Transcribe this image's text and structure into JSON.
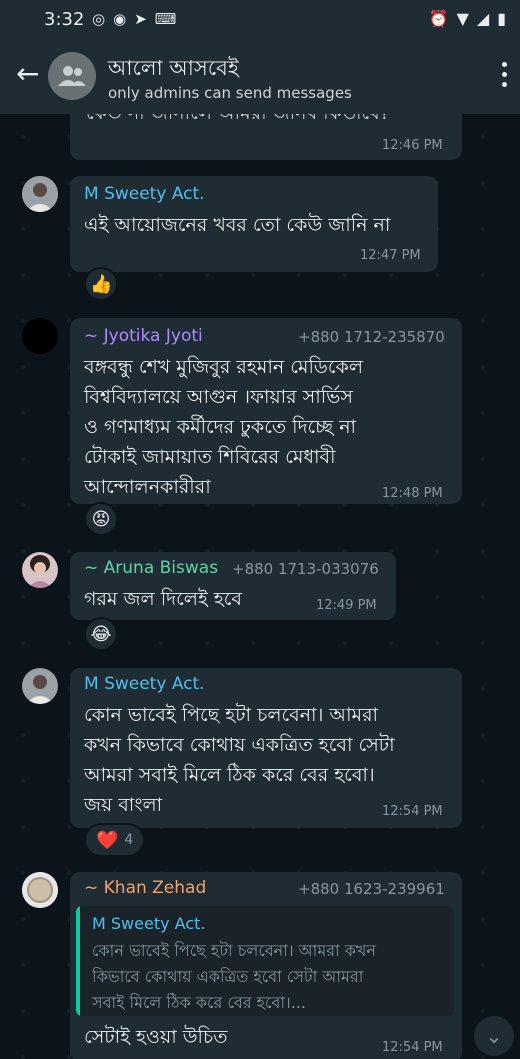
{
  "status_bar": {
    "time": "3:32",
    "left_icons": [
      "whatsapp-icon",
      "messenger-icon",
      "telegram-icon",
      "keyboard-icon"
    ],
    "right_icons": [
      "alarm-icon",
      "wifi-icon",
      "signal-icon",
      "battery-icon"
    ]
  },
  "header": {
    "title": "আলো আসবেই",
    "subtitle": "only admins can send messages"
  },
  "messages": [
    {
      "text": "কেউ না জানালে আমরা জানব কিভাবে?",
      "time": "12:46 PM"
    },
    {
      "sender": "M Sweety Act.",
      "text": "এই আয়োজনের খবর তো কেউ জানি না",
      "time": "12:47 PM",
      "reaction": "👍"
    },
    {
      "sender": "~ Jyotika Jyoti",
      "phone": "+880 1712-235870",
      "lines": [
        "বঙ্গবন্ধু শেখ মুজিবুর রহমান মেডিকেল",
        "বিশ্ববিদ্যালয়ে আগুন ।ফায়ার সার্ভিস",
        "ও গণমাধ্যম কর্মীদের ঢুকতে দিচ্ছে না",
        "টোকাই জামায়াত শিবিরের মেধাবী",
        "আন্দোলনকারীরা"
      ],
      "time": "12:48 PM",
      "reaction": "😡"
    },
    {
      "sender": "~ Aruna Biswas",
      "phone": "+880 1713-033076",
      "text": "গরম জল দিলেই  হবে",
      "time": "12:49 PM",
      "reaction": "😂"
    },
    {
      "sender": "M Sweety Act.",
      "lines": [
        "কোন ভাবেই পিছে হটা চলবেনা। আমরা",
        "কখন কিভাবে কোথায় একত্রিত হবো সেটা",
        "আমরা সবাই মিলে ঠিক করে বের হবো।",
        "জয় বাংলা"
      ],
      "time": "12:54 PM",
      "reaction": "❤️",
      "reaction_count": "4"
    },
    {
      "sender": "~ Khan Zehad",
      "phone": "+880 1623-239961",
      "quote_sender": "M Sweety Act.",
      "quote_lines": [
        "কোন ভাবেই পিছে হটা চলবেনা। আমরা কখন",
        "কিভাবে কোথায় একত্রিত হবো সেটা আমরা",
        "সবাই মিলে ঠিক করে বের হবো।..."
      ],
      "text": "সেটাই হওয়া উচিত",
      "time": "12:54 PM"
    }
  ],
  "colors": {
    "header_bg": "#1f2c34",
    "chat_bg": "#0b141a",
    "bubble_bg": "#202c33",
    "sweety": "#53bdeb",
    "jyotika": "#a98bff",
    "aruna": "#62d0a8",
    "zehad": "#f0a36b",
    "quote_accent": "#06cf9c"
  }
}
